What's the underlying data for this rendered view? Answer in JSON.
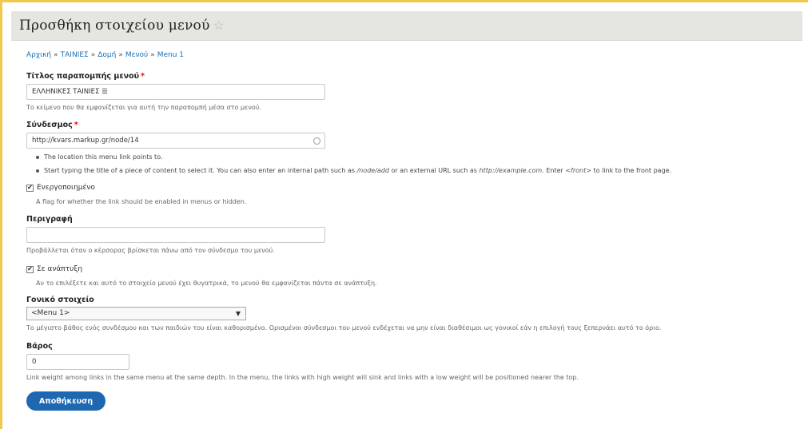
{
  "page": {
    "title": "Προσθήκη στοιχείου μενού",
    "star": "☆"
  },
  "breadcrumb": [
    "Αρχική",
    "ΤΑΙΝΙΕΣ",
    "Δομή",
    "Μενού",
    "Menu 1"
  ],
  "breadcrumb_sep": "»",
  "fields": {
    "title": {
      "label": "Τίτλος παραπομπής μενού",
      "required_mark": "*",
      "value": "ΕΛΛΗΝΙΚΕΣ ΤΑΙΝΙΕΣ ☰",
      "description": "Το κείμενο που θα εμφανίζεται για αυτή την παραπομπή μέσα στο μενού."
    },
    "link": {
      "label": "Σύνδεσμος",
      "required_mark": "*",
      "value": "http://kvars.markup.gr/node/14",
      "help1": "The location this menu link points to.",
      "help2_a": "Start typing the title of a piece of content to select it. You can also enter an internal path such as ",
      "help2_b": "/node/add",
      "help2_c": " or an external URL such as ",
      "help2_d": "http://example.com",
      "help2_e": ". Enter ",
      "help2_f": "<front>",
      "help2_g": " to link to the front page."
    },
    "enabled": {
      "label": "Ενεργοποιημένο",
      "checked": true,
      "description": "A flag for whether the link should be enabled in menus or hidden."
    },
    "description": {
      "label": "Περιγραφή",
      "value": "",
      "description": "Προβάλλεται όταν ο κέρσορας βρίσκεται πάνω από τον σύνδεσμο του μενού."
    },
    "expanded": {
      "label": "Σε ανάπτυξη",
      "checked": true,
      "description": "Αν το επιλέξετε και αυτό το στοιχείο μενού έχει θυγατρικά, το μενού θα εμφανίζεται πάντα σε ανάπτυξη."
    },
    "parent": {
      "label": "Γονικό στοιχείο",
      "value": "<Menu 1>",
      "description": "Το μέγιστο βάθος ενός συνδέσμου και των παιδιών του είναι καθορισμένο. Ορισμένοι σύνδεσμοι του μενού ενδέχεται να μην είναι διαθέσιμοι ως γονικοί εάν η επιλογή τους ξεπερνάει αυτό το όριο."
    },
    "weight": {
      "label": "Βάρος",
      "value": "0",
      "description": "Link weight among links in the same menu at the same depth. In the menu, the links with high weight will sink and links with a low weight will be positioned nearer the top."
    }
  },
  "actions": {
    "save": "Αποθήκευση"
  },
  "colors": {
    "accent": "#1d68b0",
    "link": "#1a6fb3",
    "header_bg": "#e6e6e1",
    "frame": "#f2c94c"
  }
}
